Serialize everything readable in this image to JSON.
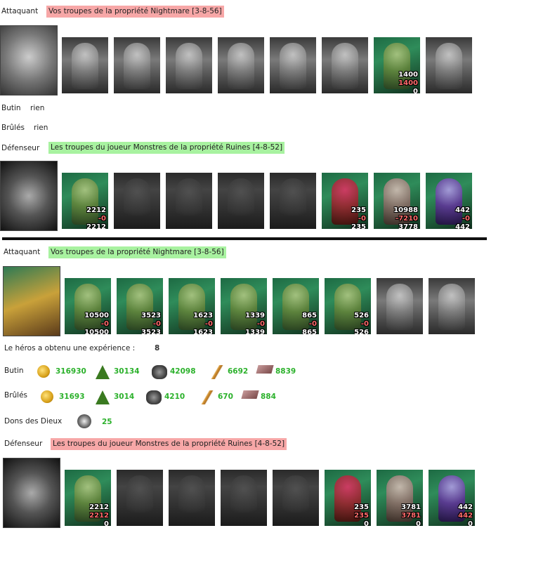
{
  "report1": {
    "attacker_label": "Attaquant",
    "attacker_tag": "Vos troupes de la propriété Nightmare [3-8-56]",
    "attacker_slots": [
      {
        "type": "gray"
      },
      {
        "type": "gray"
      },
      {
        "type": "gray"
      },
      {
        "type": "gray"
      },
      {
        "type": "gray"
      },
      {
        "type": "gray"
      },
      {
        "type": "green",
        "n1": "1400",
        "n2": "1400",
        "n3": "0"
      },
      {
        "type": "gray"
      }
    ],
    "butin_label": "Butin",
    "butin_value": "rien",
    "brules_label": "Brûlés",
    "brules_value": "rien",
    "defender_label": "Défenseur",
    "defender_tag": "Les troupes du joueur Monstres de la propriété Ruines [4-8-52]",
    "defender_slots": [
      {
        "type": "green",
        "n1": "2212",
        "n2": "-0",
        "n3": "2212"
      },
      {
        "type": "empty"
      },
      {
        "type": "empty"
      },
      {
        "type": "empty"
      },
      {
        "type": "empty"
      },
      {
        "type": "red",
        "n1": "235",
        "n2": "-0",
        "n3": "235"
      },
      {
        "type": "stone",
        "n1": "10988",
        "n2": "-7210",
        "n3": "3778"
      },
      {
        "type": "purple",
        "n1": "442",
        "n2": "-0",
        "n3": "442"
      }
    ]
  },
  "report2": {
    "attacker_label": "Attaquant",
    "attacker_tag": "Vos troupes de la propriété Nightmare [3-8-56]",
    "attacker_slots": [
      {
        "type": "green",
        "n1": "10500",
        "n2": "-0",
        "n3": "10500"
      },
      {
        "type": "green",
        "n1": "3523",
        "n2": "-0",
        "n3": "3523"
      },
      {
        "type": "green",
        "n1": "1623",
        "n2": "-0",
        "n3": "1623"
      },
      {
        "type": "green",
        "n1": "1339",
        "n2": "-0",
        "n3": "1339"
      },
      {
        "type": "green",
        "n1": "865",
        "n2": "-0",
        "n3": "865"
      },
      {
        "type": "green",
        "n1": "526",
        "n2": "-0",
        "n3": "526"
      },
      {
        "type": "gray"
      },
      {
        "type": "gray"
      }
    ],
    "xp_label": "Le héros a obtenu une expérience :",
    "xp_value": "8",
    "butin_label": "Butin",
    "butin": [
      "316930",
      "30134",
      "42098",
      "6692",
      "8839"
    ],
    "brules_label": "Brûlés",
    "brules": [
      "31693",
      "3014",
      "4210",
      "670",
      "884"
    ],
    "dons_label": "Dons des Dieux",
    "dons_value": "25",
    "defender_label": "Défenseur",
    "defender_tag": "Les troupes du joueur Monstres de la propriété Ruines [4-8-52]",
    "defender_slots": [
      {
        "type": "green",
        "n1": "2212",
        "n2": "2212",
        "n3": "0"
      },
      {
        "type": "empty"
      },
      {
        "type": "empty"
      },
      {
        "type": "empty"
      },
      {
        "type": "empty"
      },
      {
        "type": "red",
        "n1": "235",
        "n2": "235",
        "n3": "0"
      },
      {
        "type": "stone",
        "n1": "3781",
        "n2": "3781",
        "n3": "0"
      },
      {
        "type": "purple",
        "n1": "442",
        "n2": "442",
        "n3": "0"
      }
    ]
  },
  "resource_icons": [
    "gold-coins-icon",
    "wood-tree-icon",
    "ore-icon",
    "wheat-icon",
    "brick-icon"
  ],
  "colors": {
    "red_tag": "#f7a7a7",
    "green_tag": "#a8f2a0",
    "value_green": "#2bb12b",
    "loss_red": "#ff6b6b"
  }
}
